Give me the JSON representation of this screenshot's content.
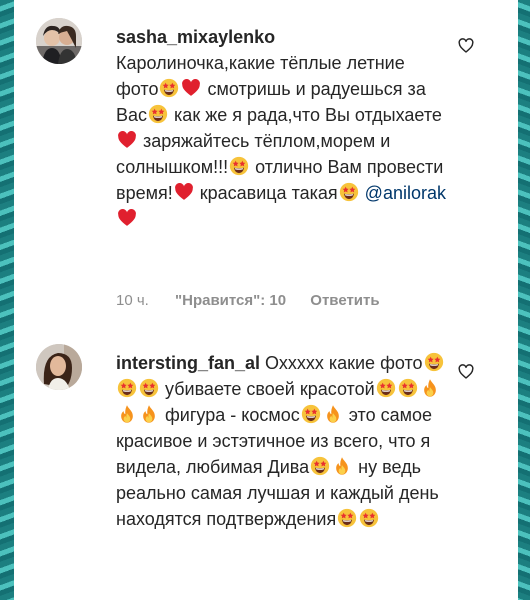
{
  "comments": [
    {
      "username": "sasha_mixaylenko",
      "segments": [
        {
          "t": "Каролиночка,какие тёплые летние фото"
        },
        {
          "e": "star-struck"
        },
        {
          "e": "heart"
        },
        {
          "t": " смотришь и радуешься за Вас"
        },
        {
          "e": "star-struck"
        },
        {
          "t": " как же я рада,что Вы отдыхаете"
        },
        {
          "e": "heart"
        },
        {
          "t": " заряжайтесь тёплом,морем и солнышком!!!"
        },
        {
          "e": "star-struck"
        },
        {
          "t": " отлично Вам провести время!"
        },
        {
          "e": "heart"
        },
        {
          "t": " красавица такая"
        },
        {
          "e": "star-struck"
        },
        {
          "t": " "
        },
        {
          "m": "@anilorak"
        },
        {
          "t": " "
        },
        {
          "e": "heart"
        }
      ],
      "time": "10 ч.",
      "likes_label": "\"Нравится\": 10",
      "reply_label": "Ответить"
    },
    {
      "username": "intersting_fan_al",
      "segments": [
        {
          "t": " Охххxx какие фото"
        },
        {
          "e": "star-struck"
        },
        {
          "e": "star-struck"
        },
        {
          "e": "star-struck"
        },
        {
          "t": " убиваете своей красотой"
        },
        {
          "e": "star-struck"
        },
        {
          "e": "star-struck"
        },
        {
          "e": "fire"
        },
        {
          "e": "fire"
        },
        {
          "e": "fire"
        },
        {
          "t": " фигура - космос"
        },
        {
          "e": "star-struck"
        },
        {
          "e": "fire"
        },
        {
          "t": " это самое красивое и эстэтичное из всего, что я видела, любимая Дива"
        },
        {
          "e": "star-struck"
        },
        {
          "e": "fire"
        },
        {
          "t": " ну ведь реально самая лучшая и каждый день находятся подтверждения"
        },
        {
          "e": "star-struck"
        },
        {
          "e": "star-struck"
        }
      ]
    }
  ],
  "icons": {
    "like": "heart-outline-icon",
    "heart": "red-heart-emoji",
    "star-struck": "star-struck-emoji",
    "fire": "fire-emoji"
  },
  "colors": {
    "text": "#262626",
    "meta": "#8e8e8e",
    "mention": "#00376b",
    "heart": "#e0202e",
    "background": "#2a9a97"
  }
}
